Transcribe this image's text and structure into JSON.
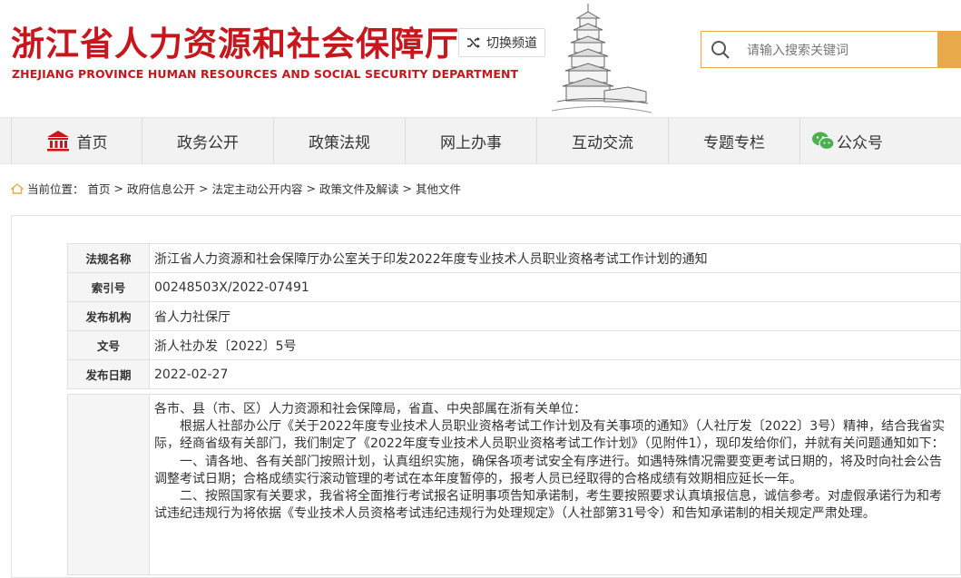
{
  "header": {
    "logo_cn": "浙江省人力资源和社会保障厅",
    "logo_en": "ZHEJIANG PROVINCE HUMAN RESOURCES AND SOCIAL SECURITY DEPARTMENT",
    "switch_label": "切换频道",
    "search_placeholder": "请输入搜索关键词",
    "brand_color": "#c8161d",
    "accent_color": "#e8a94b"
  },
  "nav": {
    "items": [
      {
        "label": "首页",
        "icon": "government-building-icon"
      },
      {
        "label": "政务公开"
      },
      {
        "label": "政策法规"
      },
      {
        "label": "网上办事"
      },
      {
        "label": "互动交流"
      },
      {
        "label": "专题专栏"
      },
      {
        "label": "公众号",
        "icon": "wechat-icon"
      }
    ]
  },
  "breadcrumb": {
    "prefix": "当前位置：",
    "items": [
      "首页",
      "政府信息公开",
      "法定主动公开内容",
      "政策文件及解读",
      "其他文件"
    ],
    "separator": ">"
  },
  "meta": {
    "rows": [
      {
        "key": "法规名称",
        "value": "浙江省人力资源和社会保障厅办公室关于印发2022年度专业技术人员职业资格考试工作计划的通知"
      },
      {
        "key": "索引号",
        "value": "00248503X/2022-07491"
      },
      {
        "key": "发布机构",
        "value": "省人力社保厅"
      },
      {
        "key": "文号",
        "value": "浙人社办发〔2022〕5号"
      },
      {
        "key": "发布日期",
        "value": "2022-02-27"
      }
    ]
  },
  "body": {
    "paragraphs": [
      "各市、县（市、区）人力资源和社会保障局，省直、中央部属在浙有关单位：",
      "根据人社部办公厅《关于2022年度专业技术人员职业资格考试工作计划及有关事项的通知》（人社厅发〔2022〕3号）精神，结合我省实际，经商省级有关部门，我们制定了《2022年度专业技术人员职业资格考试工作计划》（见附件1），现印发给你们，并就有关问题通知如下：",
      "一、请各地、各有关部门按照计划，认真组织实施，确保各项考试安全有序进行。如遇特殊情况需要变更考试日期的，将及时向社会公告调整考试日期；合格成绩实行滚动管理的考试在本年度暂停的，报考人员已经取得的合格成绩有效期相应延长一年。",
      "二、按照国家有关要求，我省将全面推行考试报名证明事项告知承诺制，考生要按照要求认真填报信息，诚信参考。对虚假承诺行为和考试违纪违规行为将依据《专业技术人员资格考试违纪违规行为处理规定》（人社部第31号令）和告知承诺制的相关规定严肃处理。"
    ]
  }
}
